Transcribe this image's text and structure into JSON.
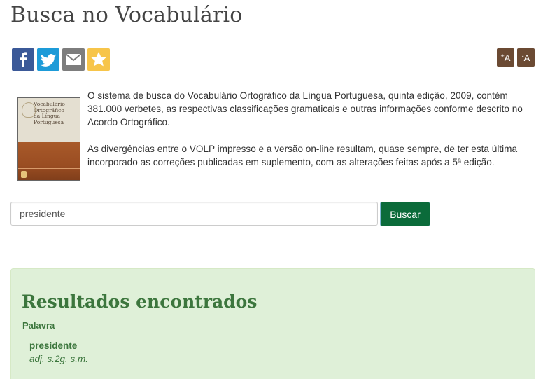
{
  "page": {
    "title": "Busca no Vocabulário"
  },
  "share": {
    "items": [
      {
        "icon": "facebook-icon",
        "color": "#3b5998"
      },
      {
        "icon": "twitter-icon",
        "color": "#1d9bd8"
      },
      {
        "icon": "email-icon",
        "color": "#7d7d7d"
      },
      {
        "icon": "star-icon",
        "color": "#f7c54a"
      }
    ]
  },
  "font_size": {
    "increase_label": "A",
    "increase_sign": "+",
    "decrease_label": "A",
    "decrease_sign": "-",
    "color": "#6b4a33"
  },
  "book": {
    "title_lines": [
      "Vocabulário",
      "Ortográfico",
      "da Língua",
      "Portuguesa"
    ]
  },
  "intro": {
    "paragraph1": "O sistema de busca do Vocabulário Ortográfico da Língua Portuguesa, quinta edição, 2009, contém 381.000 verbetes, as respectivas classificações gramaticais e outras informações conforme descrito no Acordo Ortográfico.",
    "paragraph2": "As divergências entre o VOLP impresso e a versão on-line resultam, quase sempre, de ter  esta última incorporado as correções publicadas em suplemento, com as alterações feitas após a 5ª edição."
  },
  "search": {
    "value": "presidente",
    "button_label": "Buscar",
    "button_color": "#0b6b3a"
  },
  "results": {
    "title": "Resultados encontrados",
    "column_label": "Palavra",
    "items": [
      {
        "word": "presidente",
        "classification": "adj. s.2g. s.m."
      }
    ],
    "panel_color": "#dff0d8",
    "text_color": "#3c763d"
  }
}
